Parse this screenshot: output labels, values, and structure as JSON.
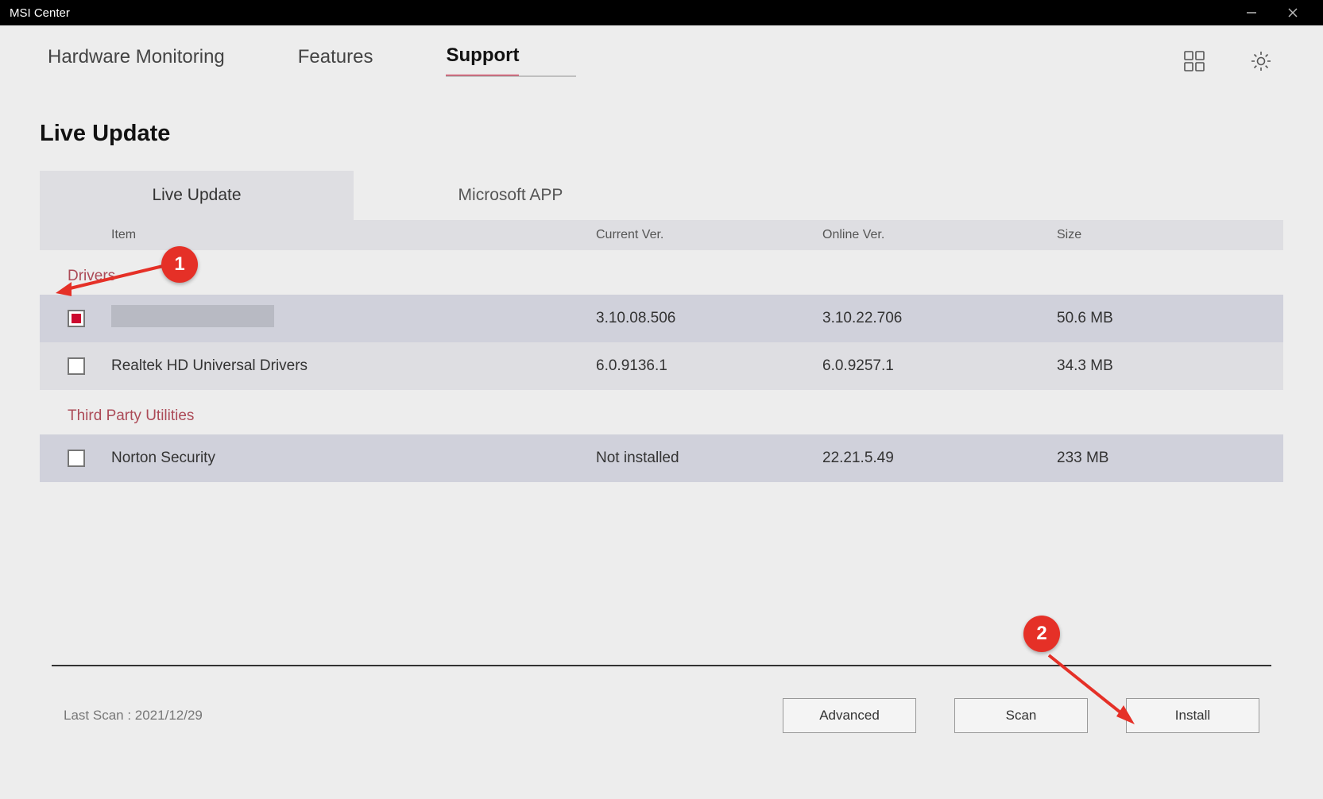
{
  "window": {
    "title": "MSI Center"
  },
  "nav": {
    "tabs": [
      "Hardware Monitoring",
      "Features",
      "Support"
    ]
  },
  "page": {
    "title": "Live Update"
  },
  "subtabs": {
    "live": "Live Update",
    "ms": "Microsoft APP"
  },
  "headers": {
    "item": "Item",
    "current": "Current Ver.",
    "online": "Online Ver.",
    "size": "Size"
  },
  "sections": {
    "drivers_label": "Drivers",
    "utils_label": "Third Party Utilities"
  },
  "rows": {
    "r0": {
      "name": "",
      "cur": "3.10.08.506",
      "on": "3.10.22.706",
      "size": "50.6 MB"
    },
    "r1": {
      "name": "Realtek HD Universal Drivers",
      "cur": "6.0.9136.1",
      "on": "6.0.9257.1",
      "size": "34.3 MB"
    },
    "r2": {
      "name": "Norton Security",
      "cur": "Not installed",
      "on": "22.21.5.49",
      "size": "233 MB"
    }
  },
  "footer": {
    "last_scan": "Last Scan : 2021/12/29",
    "advanced": "Advanced",
    "scan": "Scan",
    "install": "Install"
  },
  "callouts": {
    "c1": "1",
    "c2": "2"
  }
}
